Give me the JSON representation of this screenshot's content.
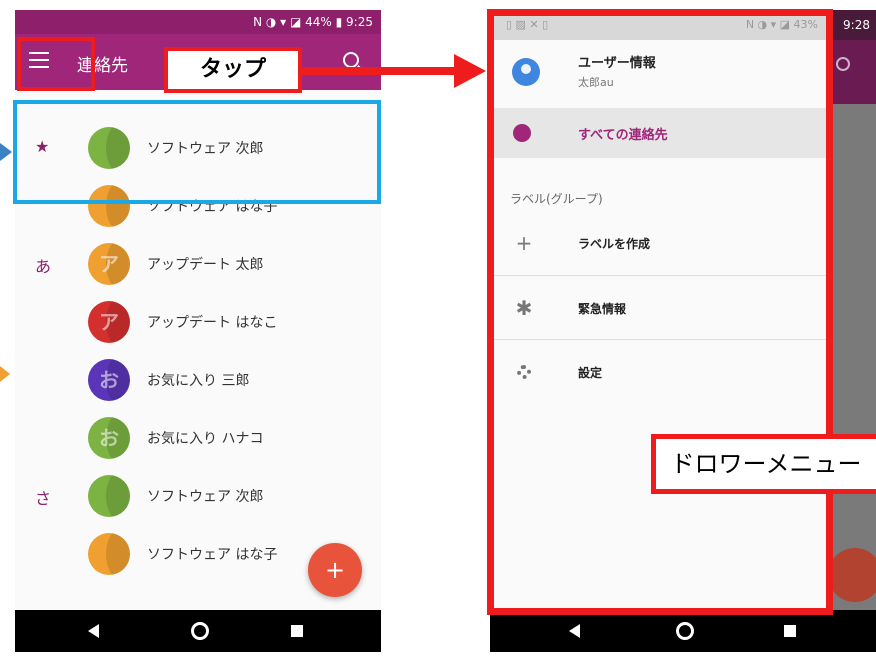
{
  "left_phone": {
    "status_text": "N ◑ ▾ ◪ 44% ▮ 9:25",
    "app_title": "連絡先",
    "contacts": [
      {
        "section": "★",
        "name": "ソフトウェア 次郎",
        "initial": "",
        "color": "#7cb342"
      },
      {
        "section": "",
        "name": "ソフトウェア はな子",
        "initial": "",
        "color": "#f0a030"
      },
      {
        "section": "あ",
        "name": "アップデート 太郎",
        "initial": "ア",
        "color": "#f0a030"
      },
      {
        "section": "",
        "name": "アップデート はなこ",
        "initial": "ア",
        "color": "#d32f2f"
      },
      {
        "section": "",
        "name": "お気に入り 三郎",
        "initial": "お",
        "color": "#5a35b8"
      },
      {
        "section": "",
        "name": "お気に入り ハナコ",
        "initial": "お",
        "color": "#7cb342"
      },
      {
        "section": "さ",
        "name": "ソフトウェア 次郎",
        "initial": "",
        "color": "#7cb342"
      },
      {
        "section": "",
        "name": "ソフトウェア はな子",
        "initial": "",
        "color": "#f0a030"
      }
    ],
    "fab_symbol": "+"
  },
  "right_phone": {
    "time": "9:28",
    "drawer_status_left": "▯ ▨ ✕ ▯",
    "drawer_status_right": "N ◑ ▾ ◪ 43%",
    "user_title": "ユーザー情報",
    "user_sub": "太郎au",
    "all_contacts": "すべての連絡先",
    "labels_section": "ラベル(グループ)",
    "items": [
      {
        "icon": "+",
        "label": "ラベルを作成"
      },
      {
        "icon": "✱",
        "label": "緊急情報"
      },
      {
        "icon": "gear",
        "label": "設定"
      }
    ]
  },
  "annotations": {
    "tap_label": "タップ",
    "drawer_label": "ドロワーメニュー"
  },
  "colors": {
    "primary": "#a0267a",
    "annotation_red": "#ee1c1c",
    "annotation_blue": "#1aa8e6"
  }
}
